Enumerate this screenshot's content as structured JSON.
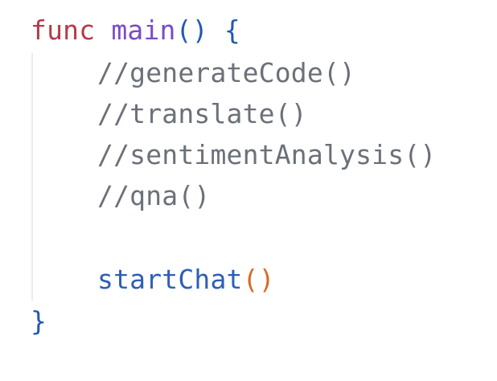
{
  "code": {
    "line1": {
      "keyword": "func",
      "function_name": "main",
      "params": "()",
      "open_brace": "{"
    },
    "comments": [
      "//generateCode()",
      "//translate()",
      "//sentimentAnalysis()",
      "//qna()"
    ],
    "call": {
      "name": "startChat",
      "parens": "()"
    },
    "close_brace": "}"
  },
  "colors": {
    "keyword": "#b83a47",
    "function_name": "#7a4bc4",
    "punctuation": "#2357b5",
    "comment": "#6b7079",
    "call": "#2d5fb5",
    "call_parens": "#d66a22",
    "indent_guide": "#ebebeb"
  }
}
